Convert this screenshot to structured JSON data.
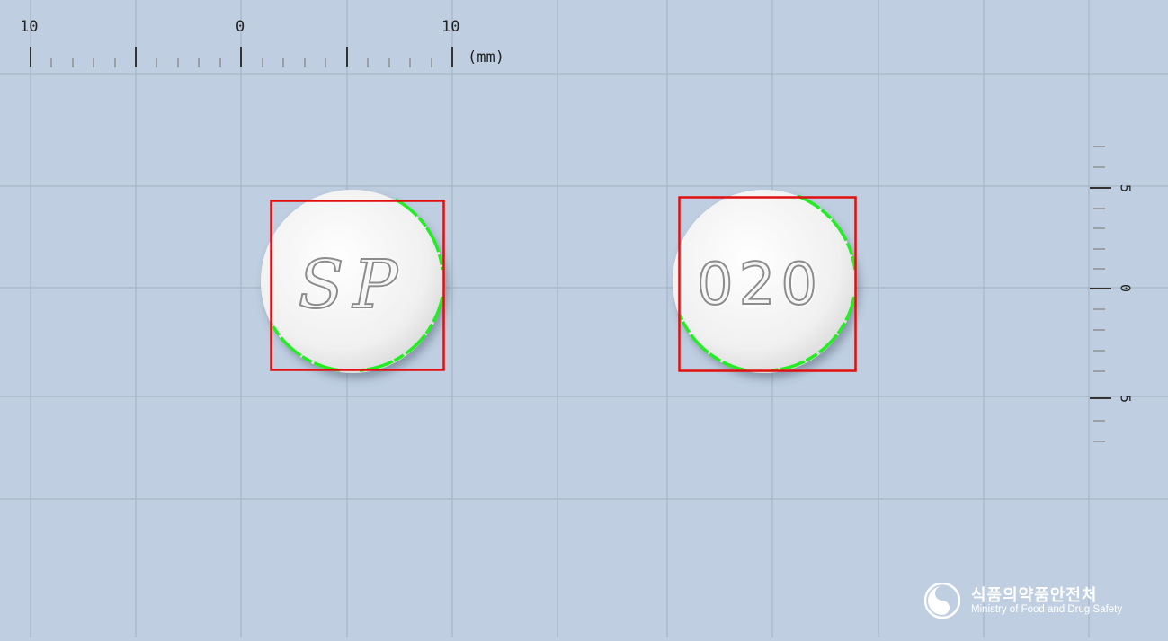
{
  "ruler_top": {
    "labels": [
      "10",
      "0",
      "10"
    ],
    "unit": "(mm)"
  },
  "ruler_side": {
    "labels": [
      "5",
      "0",
      "5"
    ]
  },
  "pills": [
    {
      "imprint": "SP",
      "color": "#f4f4f4"
    },
    {
      "imprint": "020",
      "color": "#f4f4f4"
    }
  ],
  "colors": {
    "background": "#bfcfe1",
    "grid": "#a7b7c8",
    "detection_box": "#e01010",
    "edge_trace": "#22ee22"
  },
  "logo": {
    "name_ko": "식품의약품안전처",
    "name_en": "Ministry of Food and Drug Safety",
    "icon": "mfds-emblem-icon"
  }
}
